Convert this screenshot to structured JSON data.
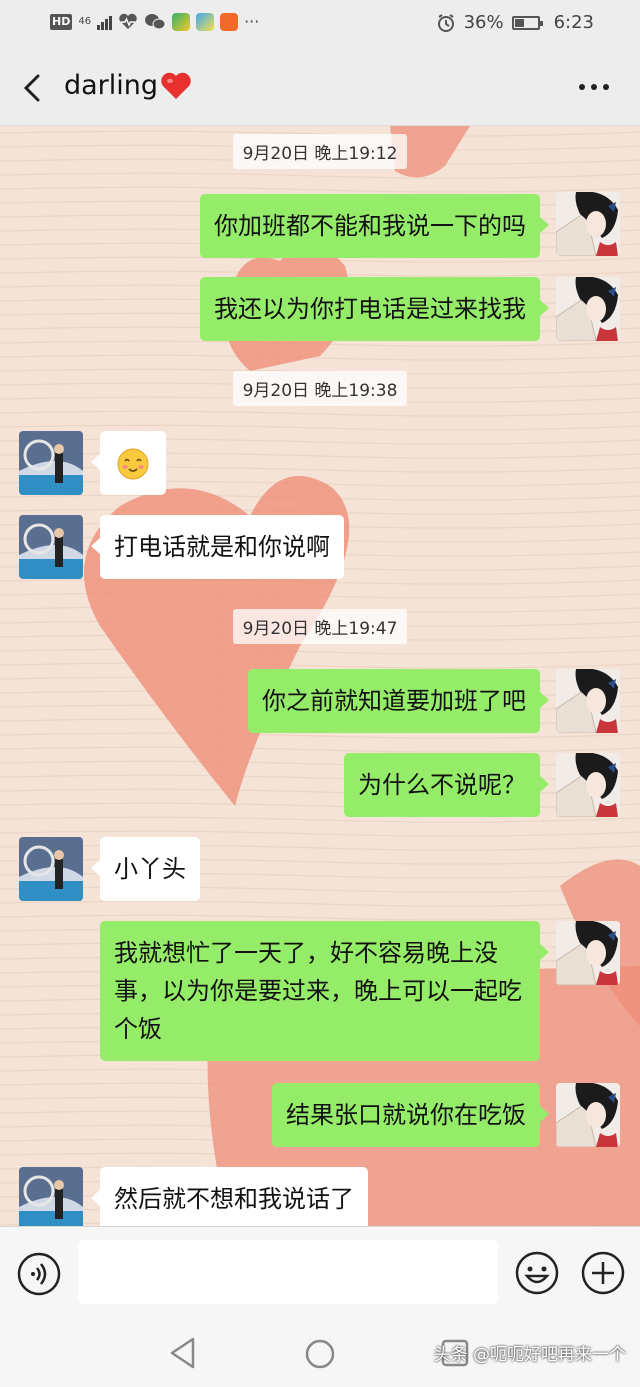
{
  "status_bar": {
    "hd": "HD",
    "network": "46",
    "battery_percent": "36%",
    "time": "6:23",
    "more": "···",
    "icons": [
      "alarm-icon",
      "battery-icon",
      "signal-icon",
      "wechat-icon",
      "health-icon"
    ]
  },
  "header": {
    "title": "darling",
    "title_emoji": "heart-icon"
  },
  "chat": {
    "timestamps": [
      "9月20日 晚上19:12",
      "9月20日 晚上19:38",
      "9月20日 晚上19:47"
    ],
    "messages": [
      {
        "side": "me",
        "text": "你加班都不能和我说一下的吗"
      },
      {
        "side": "me",
        "text": "我还以为你打电话是过来找我"
      },
      {
        "side": "other",
        "text": "",
        "emoji": "blush-emoji"
      },
      {
        "side": "other",
        "text": "打电话就是和你说啊"
      },
      {
        "side": "me",
        "text": "你之前就知道要加班了吧"
      },
      {
        "side": "me",
        "text": "为什么不说呢？"
      },
      {
        "side": "other",
        "text": "小丫头"
      },
      {
        "side": "me",
        "text": "我就想忙了一天了，好不容易晚上没事，以为你是要过来，晚上可以一起吃个饭"
      },
      {
        "side": "me",
        "text": "结果张口就说你在吃饭"
      },
      {
        "side": "other",
        "text": "然后就不想和我说话了"
      }
    ]
  },
  "input": {
    "placeholder": ""
  },
  "watermark": "头条 @呃呃好吧再来一个"
}
